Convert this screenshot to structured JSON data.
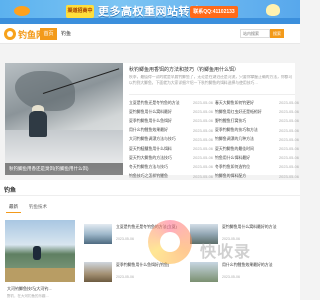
{
  "banner": {
    "tag": "渠道招商中",
    "slogan": "更多高权重网站转让",
    "contact": "联系QQ:41102133"
  },
  "header": {
    "logo_text": "钓鱼网",
    "nav_home": "首页",
    "nav_fishing": "钓鱼",
    "search_placeholder": "站内搜索",
    "search_button": "搜索"
  },
  "featured": {
    "image_caption": "秋钓鲫鱼用香还是臭饵(钓鲫鱼用什么饵)",
    "title": "秋钓鲫鱼用香饵的方法和技巧（钓鲫鱼用什么饵）",
    "description": "秋季，最值得一试的就是早晨钓鲫鱼了，无论是在湖泊还是河流，只要你掌握正确的方法，你都可以钓到大鲫鱼，下面就为大家详细介绍一下秋钓鲫鱼的饵料选择与使用技巧…",
    "left_list": [
      {
        "title": "立夏是钓鱼还是冬钓鱼的方法",
        "date": "2023-05-06"
      },
      {
        "title": "夏钓鲫鱼用什么窝料最好",
        "date": "2023-05-06"
      },
      {
        "title": "夏季钓鲫鱼用什么鱼饵好",
        "date": "2023-05-06"
      },
      {
        "title": "用什么钓鲤鱼效果最好",
        "date": "2023-05-06"
      },
      {
        "title": "大河钓鲫鱼调漂方法与技巧",
        "date": "2023-05-06"
      },
      {
        "title": "夏天钓鲢鳙鱼用什么饵料",
        "date": "2023-05-06"
      },
      {
        "title": "夏天钓大鲫鱼的方法技巧",
        "date": "2023-05-06"
      },
      {
        "title": "冬天钓鲫鱼方法与技巧",
        "date": "2023-05-06"
      },
      {
        "title": "钓鱼技巧之怎样钓鲤鱼",
        "date": "2023-05-06"
      }
    ],
    "right_list": [
      {
        "title": "春天大鲫鱼如何钓更好",
        "date": "2023-05-06"
      },
      {
        "title": "钓鲫鱼用红虫好还是蚯蚓好",
        "date": "2023-05-06"
      },
      {
        "title": "野钓鲤鱼打窝技巧",
        "date": "2023-05-06"
      },
      {
        "title": "夏季钓鲫鱼的技巧和方法",
        "date": "2023-05-06"
      },
      {
        "title": "钓鲫鱼调漂的几种方法",
        "date": "2023-05-06"
      },
      {
        "title": "夏天钓鲫鱼的最佳时间",
        "date": "2023-05-06"
      },
      {
        "title": "钓鱼用什么饵料最好",
        "date": "2023-05-06"
      },
      {
        "title": "冬季钓鱼如何选钓位",
        "date": "2023-05-06"
      },
      {
        "title": "钓鲫鱼的饵料配方",
        "date": "2023-05-06"
      }
    ]
  },
  "section2": {
    "title": "钓鱼",
    "tabs": [
      "最新",
      "钓鱼技术"
    ],
    "big_card": {
      "title": "大河钓鲫鱼技巧(大河钓...",
      "subtitle": "野钓，在大河钓鱼的乐趣…"
    },
    "minis": [
      {
        "title": "立夏是钓鱼还是冬钓鱼的方法(立夏)",
        "date": "2023-05-06"
      },
      {
        "title": "夏钓鲫鱼用什么窝料最好的方法",
        "date": "2023-05-06"
      },
      {
        "title": "夏季钓鲫鱼用什么鱼饵好(钓鱼)",
        "date": "2023-05-06"
      },
      {
        "title": "用什么钓鲤鱼效果最好的方法",
        "date": "2023-05-06"
      }
    ]
  },
  "watermark": {
    "text": "快收录"
  }
}
